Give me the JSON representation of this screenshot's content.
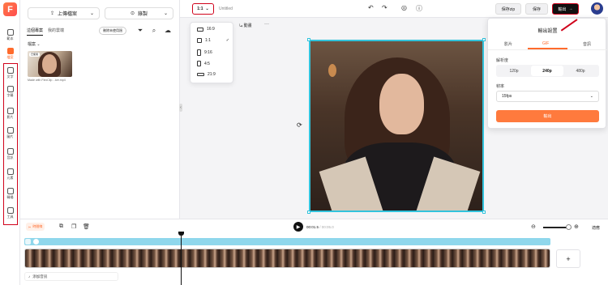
{
  "app": {
    "logo_letter": "F"
  },
  "rail": {
    "items": [
      {
        "label": "範本",
        "icon": "template-icon"
      },
      {
        "label": "檔案",
        "icon": "folder-icon",
        "active": true
      },
      {
        "label": "文字",
        "icon": "text-icon"
      },
      {
        "label": "字幕",
        "icon": "subtitle-icon"
      },
      {
        "label": "影片",
        "icon": "video-icon"
      },
      {
        "label": "圖片",
        "icon": "image-icon"
      },
      {
        "label": "音訊",
        "icon": "music-icon"
      },
      {
        "label": "元素",
        "icon": "elements-icon"
      },
      {
        "label": "轉場",
        "icon": "transition-icon"
      },
      {
        "label": "工具",
        "icon": "tools-icon"
      }
    ]
  },
  "panel": {
    "upload_label": "上傳檔案",
    "record_label": "錄製",
    "tabs": [
      "這個專案",
      "我的雲端"
    ],
    "delete_unused_label": "刪除未使用過",
    "filter_label": "檔案",
    "thumb_tag": "已使用",
    "thumb_caption": "Made with FlexClip…ker.mp4"
  },
  "topbar": {
    "ratio": "1:1",
    "project_title": "Untitled",
    "save_zip": "保存zip",
    "save": "保存",
    "export": "輸出"
  },
  "toolbar": {
    "animation_label": "動畫",
    "more": "···"
  },
  "ratio_menu": {
    "options": [
      {
        "label": "16:9"
      },
      {
        "label": "1:1",
        "selected": true
      },
      {
        "label": "9:16"
      },
      {
        "label": "4:5"
      },
      {
        "label": "21:9"
      }
    ]
  },
  "export_panel": {
    "title": "輸出設置",
    "tabs": [
      "影片",
      "GIF",
      "音訊"
    ],
    "active_tab": "GIF",
    "resolution_label": "解析度",
    "resolutions": [
      "120p",
      "240p",
      "480p"
    ],
    "selected_resolution": "240p",
    "fps_label": "幀率",
    "fps_value": "15fps",
    "export_button": "輸出"
  },
  "timeline": {
    "fit_label": "適應",
    "current_time": "00:01.5",
    "total_time": "00:05.0",
    "add_audio": "添加音訊",
    "add_button": "+",
    "record_mini": "時間線"
  },
  "colors": {
    "accent": "#ff6b2c",
    "selection": "#32c3dc",
    "highlight": "#d0021b"
  }
}
